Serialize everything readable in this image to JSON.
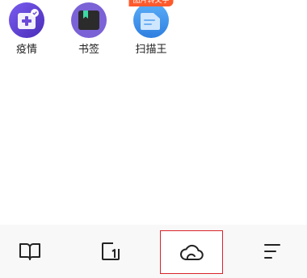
{
  "apps": [
    {
      "label": "疫情",
      "icon": "epidemic-icon",
      "color": "#5b3fd1"
    },
    {
      "label": "书签",
      "icon": "bookmark-icon",
      "color": "#6b52c9"
    },
    {
      "label": "扫描王",
      "icon": "scanner-icon",
      "color": "#3d8ee8",
      "badge": "图片转文字",
      "badge_color": "#ff5a2c"
    }
  ],
  "tabbar": {
    "tabs": [
      {
        "icon": "book-icon"
      },
      {
        "icon": "tab-window-icon"
      },
      {
        "icon": "cloud-icon",
        "selected": true
      },
      {
        "icon": "menu-icon"
      }
    ],
    "selected_border_color": "#d9232a"
  }
}
